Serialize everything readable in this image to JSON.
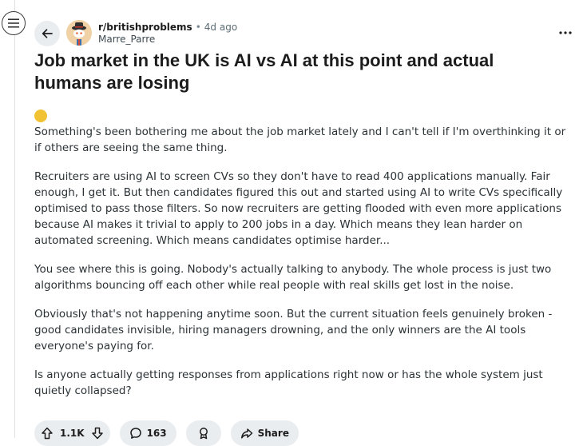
{
  "post": {
    "subreddit": "r/britishproblems",
    "separator": "•",
    "age": "4d ago",
    "author": "Marre_Parre",
    "title": "Job market in the UK is AI vs AI at this point and actual humans are losing",
    "paragraphs": [
      "Something's been bothering me about the job market lately and I can't tell if I'm overthinking it or if others are seeing the same thing.",
      "Recruiters are using AI to screen CVs so they don't have to read 400 applications manually. Fair enough, I get it. But then candidates figured this out and started using AI to write CVs specifically optimised to pass those filters. So now recruiters are getting flooded with even more applications because AI makes it trivial to apply to 200 jobs in a day. Which means they lean harder on automated screening. Which means candidates optimise harder...",
      "You see where this is going. Nobody's actually talking to anybody. The whole process is just two algorithms bouncing off each other while real people with real skills get lost in the noise.",
      "Obviously that's not happening anytime soon. But the current situation feels genuinely broken - good candidates invisible, hiring managers drowning, and the only winners are the AI tools everyone's paying for.",
      "Is anyone actually getting responses from applications right now or has the whole system just quietly collapsed?"
    ]
  },
  "actions": {
    "score": "1.1K",
    "comments": "163",
    "share_label": "Share"
  },
  "icons": {
    "menu": "hamburger-icon",
    "back": "arrow-left-icon",
    "overflow": "more-horizontal-icon",
    "upvote": "upvote-arrow-icon",
    "downvote": "downvote-arrow-icon",
    "comment": "comment-bubble-icon",
    "award": "award-icon",
    "share": "share-arrow-icon"
  },
  "colors": {
    "flair": "#f1c232",
    "pill_bg": "#eaedef"
  }
}
